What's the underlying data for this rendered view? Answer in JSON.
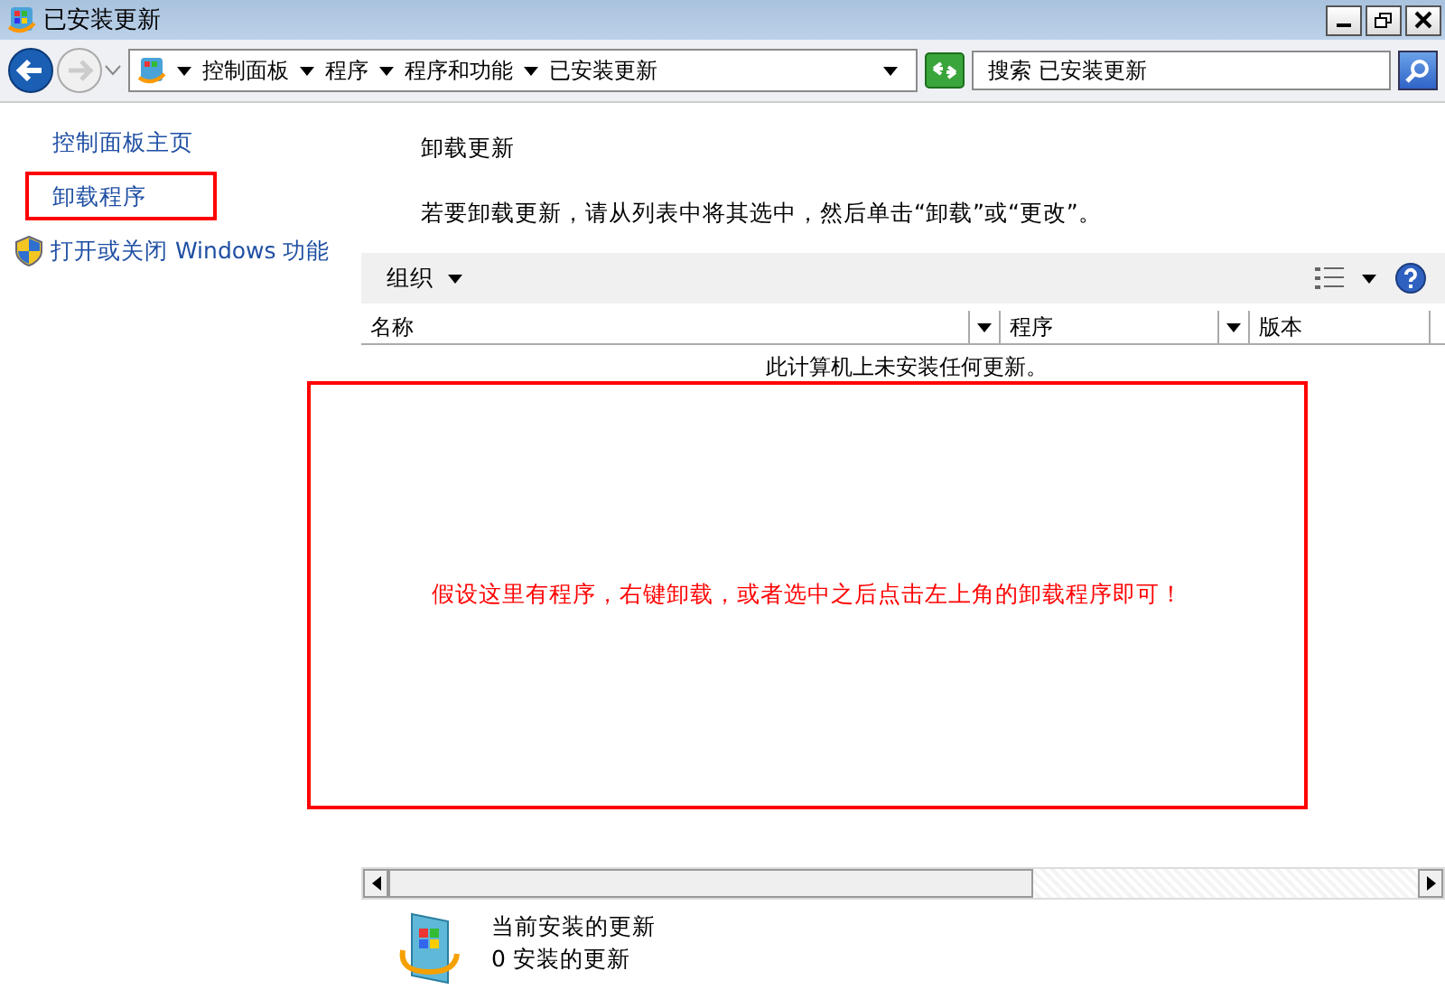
{
  "window": {
    "title": "已安装更新"
  },
  "address_bar": {
    "breadcrumbs": [
      "控制面板",
      "程序",
      "程序和功能",
      "已安装更新"
    ],
    "search": {
      "placeholder": "搜索 已安装更新"
    }
  },
  "sidebar": {
    "items": [
      {
        "label": "控制面板主页",
        "kind": "link",
        "boxed": false
      },
      {
        "label": "卸载程序",
        "kind": "link",
        "boxed": true
      },
      {
        "label": "打开或关闭 Windows 功能",
        "kind": "shield",
        "boxed": false
      }
    ]
  },
  "content": {
    "heading": "卸载更新",
    "description": "若要卸载更新，请从列表中将其选中，然后单击“卸载”或“更改”。"
  },
  "toolbar": {
    "organize": "组织"
  },
  "table": {
    "columns": [
      "名称",
      "程序",
      "版本"
    ],
    "empty_message": "此计算机上未安装任何更新。"
  },
  "details": {
    "title": "当前安装的更新",
    "count": "0 安装的更新"
  },
  "annotations": [
    {
      "kind": "note",
      "text": "假设这里有程序，右键卸载，或者选中之后点击左上角的卸载程序即可！"
    }
  ]
}
